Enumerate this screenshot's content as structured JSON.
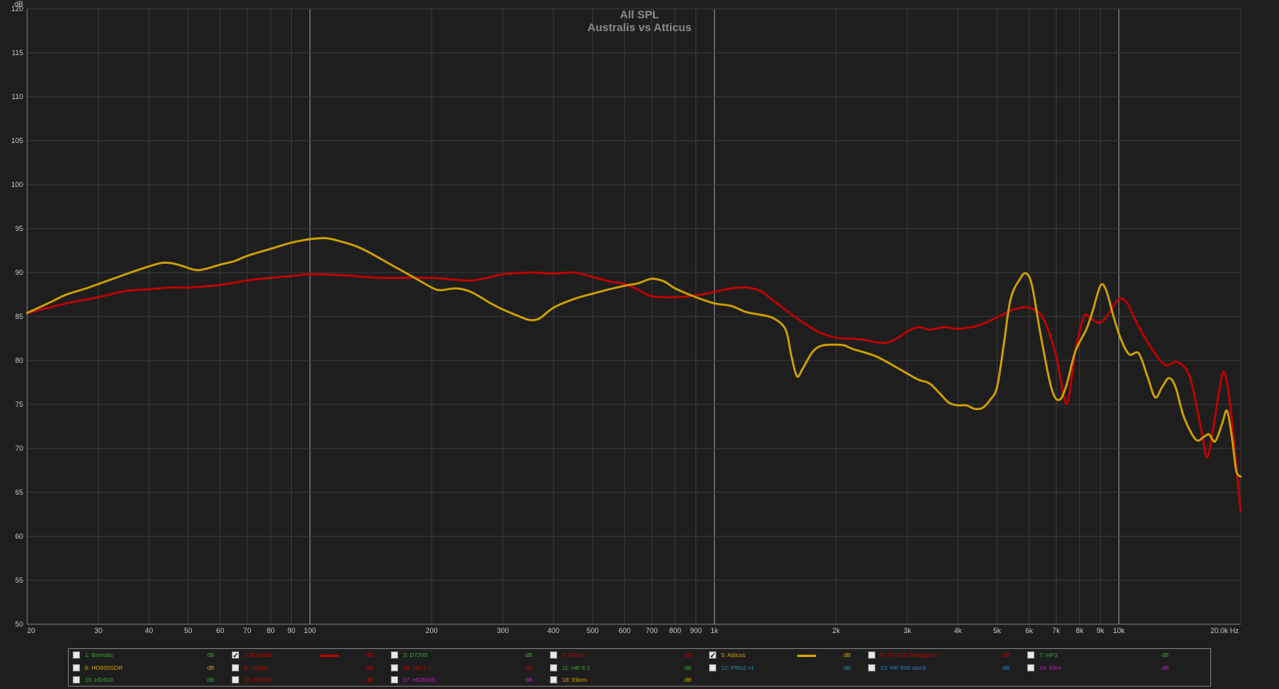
{
  "chart_data": {
    "type": "line",
    "title": "All SPL",
    "subtitle": "Australis vs Atticus",
    "ylabel": "dB",
    "xunit": "Hz",
    "xscale": "log",
    "xlim": [
      20,
      20000
    ],
    "ylim": [
      50,
      120
    ],
    "xticks": [
      {
        "v": 20,
        "label": "20"
      },
      {
        "v": 30,
        "label": "30"
      },
      {
        "v": 40,
        "label": "40"
      },
      {
        "v": 50,
        "label": "50"
      },
      {
        "v": 60,
        "label": "60"
      },
      {
        "v": 70,
        "label": "70"
      },
      {
        "v": 80,
        "label": "80"
      },
      {
        "v": 90,
        "label": "90"
      },
      {
        "v": 100,
        "label": "100"
      },
      {
        "v": 200,
        "label": "200"
      },
      {
        "v": 300,
        "label": "300"
      },
      {
        "v": 400,
        "label": "400"
      },
      {
        "v": 500,
        "label": "500"
      },
      {
        "v": 600,
        "label": "600"
      },
      {
        "v": 700,
        "label": "700"
      },
      {
        "v": 800,
        "label": "800"
      },
      {
        "v": 900,
        "label": "900"
      },
      {
        "v": 1000,
        "label": "1k"
      },
      {
        "v": 2000,
        "label": "2k"
      },
      {
        "v": 3000,
        "label": "3k"
      },
      {
        "v": 4000,
        "label": "4k"
      },
      {
        "v": 5000,
        "label": "5k"
      },
      {
        "v": 6000,
        "label": "6k"
      },
      {
        "v": 7000,
        "label": "7k"
      },
      {
        "v": 8000,
        "label": "8k"
      },
      {
        "v": 9000,
        "label": "9k"
      },
      {
        "v": 10000,
        "label": "10k"
      },
      {
        "v": 20000,
        "label": "20.0k Hz"
      }
    ],
    "yticks": [
      50,
      55,
      60,
      65,
      70,
      75,
      80,
      85,
      90,
      95,
      100,
      105,
      110,
      115,
      120
    ],
    "ytick_top_label": "120",
    "major_x_lines": [
      100,
      1000,
      10000
    ],
    "grid": true,
    "legend": "bottom",
    "series": [
      {
        "name": "2: Australis",
        "color": "#c00000",
        "points": [
          [
            20,
            85.4
          ],
          [
            25,
            86.5
          ],
          [
            30,
            87.2
          ],
          [
            35,
            87.9
          ],
          [
            40,
            88.1
          ],
          [
            45,
            88.3
          ],
          [
            50,
            88.3
          ],
          [
            60,
            88.6
          ],
          [
            70,
            89.1
          ],
          [
            80,
            89.4
          ],
          [
            90,
            89.6
          ],
          [
            100,
            89.8
          ],
          [
            120,
            89.7
          ],
          [
            150,
            89.4
          ],
          [
            200,
            89.4
          ],
          [
            250,
            89.1
          ],
          [
            300,
            89.8
          ],
          [
            350,
            90.0
          ],
          [
            400,
            89.9
          ],
          [
            450,
            90.0
          ],
          [
            500,
            89.5
          ],
          [
            550,
            89.0
          ],
          [
            600,
            88.7
          ],
          [
            650,
            88.0
          ],
          [
            700,
            87.3
          ],
          [
            800,
            87.2
          ],
          [
            900,
            87.4
          ],
          [
            1000,
            87.8
          ],
          [
            1100,
            88.2
          ],
          [
            1200,
            88.3
          ],
          [
            1300,
            87.9
          ],
          [
            1400,
            86.8
          ],
          [
            1600,
            84.8
          ],
          [
            1800,
            83.3
          ],
          [
            2000,
            82.6
          ],
          [
            2300,
            82.4
          ],
          [
            2600,
            82.0
          ],
          [
            2800,
            82.4
          ],
          [
            3000,
            83.3
          ],
          [
            3200,
            83.8
          ],
          [
            3400,
            83.5
          ],
          [
            3700,
            83.8
          ],
          [
            4000,
            83.6
          ],
          [
            4500,
            84.0
          ],
          [
            5000,
            84.9
          ],
          [
            5500,
            85.8
          ],
          [
            6000,
            86.0
          ],
          [
            6500,
            84.8
          ],
          [
            7000,
            80.5
          ],
          [
            7300,
            76.0
          ],
          [
            7500,
            75.5
          ],
          [
            7800,
            81.0
          ],
          [
            8200,
            85.0
          ],
          [
            8500,
            84.8
          ],
          [
            9000,
            84.3
          ],
          [
            9500,
            85.5
          ],
          [
            10000,
            87.0
          ],
          [
            10500,
            86.5
          ],
          [
            11000,
            84.5
          ],
          [
            12000,
            81.5
          ],
          [
            13000,
            79.5
          ],
          [
            14000,
            79.8
          ],
          [
            15000,
            78.0
          ],
          [
            16000,
            72.0
          ],
          [
            16500,
            69.0
          ],
          [
            17000,
            71.5
          ],
          [
            18000,
            78.3
          ],
          [
            18500,
            77.5
          ],
          [
            19000,
            73.5
          ],
          [
            20000,
            62.8
          ]
        ]
      },
      {
        "name": "5: Atticus",
        "color": "#d0a000",
        "points": [
          [
            20,
            85.4
          ],
          [
            23,
            86.7
          ],
          [
            25,
            87.5
          ],
          [
            28,
            88.2
          ],
          [
            30,
            88.7
          ],
          [
            35,
            89.8
          ],
          [
            40,
            90.7
          ],
          [
            43,
            91.1
          ],
          [
            45,
            91.1
          ],
          [
            48,
            90.8
          ],
          [
            52,
            90.3
          ],
          [
            55,
            90.4
          ],
          [
            60,
            90.9
          ],
          [
            65,
            91.3
          ],
          [
            70,
            91.9
          ],
          [
            80,
            92.7
          ],
          [
            90,
            93.4
          ],
          [
            100,
            93.8
          ],
          [
            110,
            93.9
          ],
          [
            120,
            93.5
          ],
          [
            130,
            93.0
          ],
          [
            140,
            92.3
          ],
          [
            160,
            90.8
          ],
          [
            180,
            89.5
          ],
          [
            200,
            88.3
          ],
          [
            210,
            88.0
          ],
          [
            230,
            88.2
          ],
          [
            250,
            87.8
          ],
          [
            280,
            86.5
          ],
          [
            300,
            85.8
          ],
          [
            330,
            85.0
          ],
          [
            350,
            84.6
          ],
          [
            370,
            84.8
          ],
          [
            400,
            86.0
          ],
          [
            450,
            87.0
          ],
          [
            500,
            87.6
          ],
          [
            550,
            88.1
          ],
          [
            600,
            88.5
          ],
          [
            650,
            88.8
          ],
          [
            700,
            89.3
          ],
          [
            750,
            89.0
          ],
          [
            800,
            88.2
          ],
          [
            900,
            87.2
          ],
          [
            1000,
            86.5
          ],
          [
            1100,
            86.2
          ],
          [
            1200,
            85.5
          ],
          [
            1300,
            85.2
          ],
          [
            1400,
            84.8
          ],
          [
            1500,
            83.5
          ],
          [
            1550,
            80.5
          ],
          [
            1600,
            78.2
          ],
          [
            1650,
            79.0
          ],
          [
            1750,
            81.0
          ],
          [
            1850,
            81.7
          ],
          [
            2000,
            81.8
          ],
          [
            2100,
            81.7
          ],
          [
            2200,
            81.3
          ],
          [
            2500,
            80.5
          ],
          [
            2800,
            79.3
          ],
          [
            3000,
            78.5
          ],
          [
            3200,
            77.8
          ],
          [
            3400,
            77.4
          ],
          [
            3600,
            76.3
          ],
          [
            3800,
            75.2
          ],
          [
            4000,
            74.9
          ],
          [
            4200,
            74.9
          ],
          [
            4400,
            74.5
          ],
          [
            4600,
            74.6
          ],
          [
            4800,
            75.5
          ],
          [
            5000,
            77.0
          ],
          [
            5200,
            82.0
          ],
          [
            5400,
            87.0
          ],
          [
            5700,
            89.3
          ],
          [
            5900,
            89.9
          ],
          [
            6100,
            88.5
          ],
          [
            6400,
            83.0
          ],
          [
            6800,
            77.0
          ],
          [
            7100,
            75.5
          ],
          [
            7400,
            77.0
          ],
          [
            7800,
            81.0
          ],
          [
            8300,
            83.5
          ],
          [
            8600,
            85.5
          ],
          [
            9000,
            88.5
          ],
          [
            9300,
            88.0
          ],
          [
            9700,
            85.0
          ],
          [
            10100,
            82.5
          ],
          [
            10600,
            80.7
          ],
          [
            11200,
            80.8
          ],
          [
            11800,
            78.0
          ],
          [
            12300,
            75.8
          ],
          [
            12800,
            77.0
          ],
          [
            13300,
            78.0
          ],
          [
            13800,
            77.0
          ],
          [
            14500,
            73.5
          ],
          [
            15500,
            71.0
          ],
          [
            16200,
            71.3
          ],
          [
            16700,
            71.6
          ],
          [
            17300,
            70.8
          ],
          [
            18000,
            72.8
          ],
          [
            18500,
            74.3
          ],
          [
            19000,
            71.5
          ],
          [
            19500,
            67.5
          ],
          [
            20000,
            66.8
          ]
        ]
      }
    ]
  },
  "legend": {
    "items": [
      {
        "label": "1: Borealis",
        "checked": false,
        "color": "#3ca03c"
      },
      {
        "label": "2: Australis",
        "checked": true,
        "color": "#c00000",
        "swatch": true
      },
      {
        "label": "3: D7200",
        "checked": false,
        "color": "#3ca03c"
      },
      {
        "label": "4: Eikon",
        "checked": false,
        "color": "#c00000"
      },
      {
        "label": "5: Atticus",
        "checked": true,
        "color": "#d0a000",
        "swatch": true
      },
      {
        "label": "6: TH-X00 Mahogany",
        "checked": false,
        "color": "#c00000"
      },
      {
        "label": "7: HP3",
        "checked": false,
        "color": "#3ca03c"
      },
      {
        "label": "8: HD800SDR",
        "checked": false,
        "color": "#d0a000"
      },
      {
        "label": "9: Utopia",
        "checked": false,
        "color": "#c00000"
      },
      {
        "label": "10: HE-6 1",
        "checked": false,
        "color": "#c00000"
      },
      {
        "label": "11: HE-6 2",
        "checked": false,
        "color": "#3ca03c"
      },
      {
        "label": "12: PMx2 v1",
        "checked": false,
        "color": "#2090a0"
      },
      {
        "label": "13: HE-500 stock",
        "checked": false,
        "color": "#2080d0"
      },
      {
        "label": "14: Elex",
        "checked": false,
        "color": "#c020c0"
      },
      {
        "label": "15: HD600",
        "checked": false,
        "color": "#3ca03c"
      },
      {
        "label": "16: HD650",
        "checked": false,
        "color": "#c00000"
      },
      {
        "label": "17: HD660S",
        "checked": false,
        "color": "#c020c0"
      },
      {
        "label": "18: Eikon",
        "checked": false,
        "color": "#d0a000"
      }
    ],
    "unit_label": "dB"
  }
}
